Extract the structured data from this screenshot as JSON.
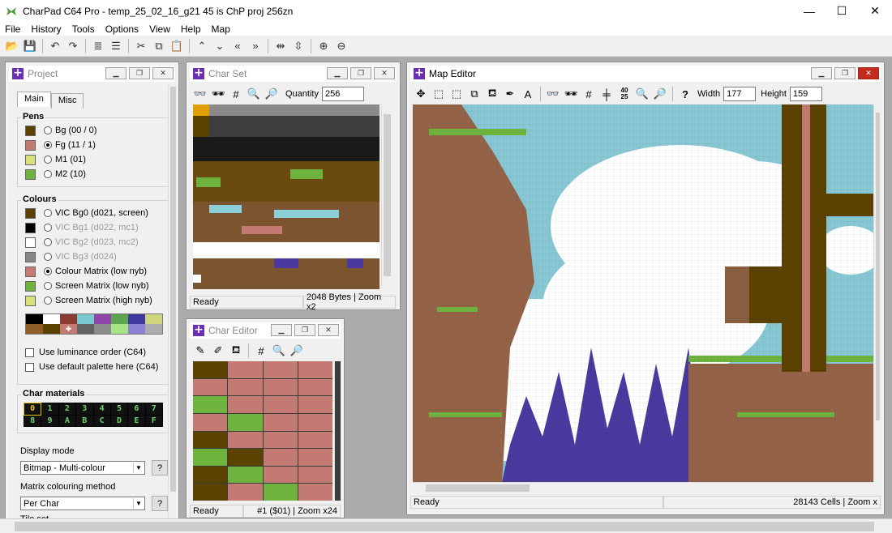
{
  "window": {
    "title": "CharPad C64 Pro - temp_25_02_16_g21 45 is ChP proj 256zn",
    "minimize": "—",
    "maximize": "☐",
    "close": "✕"
  },
  "menu": [
    "File",
    "History",
    "Tools",
    "Options",
    "View",
    "Help",
    "Map"
  ],
  "project": {
    "title": "Project",
    "tabs": [
      "Main",
      "Misc"
    ],
    "pens_title": "Pens",
    "pens": [
      {
        "label": "Bg (00 / 0)",
        "color": "#5b4200",
        "selected": false
      },
      {
        "label": "Fg (11 / 1)",
        "color": "#c27a72",
        "selected": true
      },
      {
        "label": "M1 (01)",
        "color": "#d9e07c",
        "selected": false
      },
      {
        "label": "M2 (10)",
        "color": "#6fb33f",
        "selected": false
      }
    ],
    "colours_title": "Colours",
    "colours": [
      {
        "label": "VIC Bg0 (d021, screen)",
        "color": "#5b4200",
        "enabled": true,
        "selected": false
      },
      {
        "label": "VIC Bg1 (d022, mc1)",
        "color": "#000000",
        "enabled": false,
        "selected": false
      },
      {
        "label": "VIC Bg2 (d023, mc2)",
        "color": "#ffffff",
        "enabled": false,
        "selected": false
      },
      {
        "label": "VIC Bg3 (d024)",
        "color": "#888888",
        "enabled": false,
        "selected": false
      },
      {
        "label": "Colour Matrix (low nyb)",
        "color": "#c27a72",
        "enabled": true,
        "selected": true
      },
      {
        "label": "Screen Matrix (low nyb)",
        "color": "#6fb33f",
        "enabled": true,
        "selected": false
      },
      {
        "label": "Screen Matrix (high nyb)",
        "color": "#d9e07c",
        "enabled": true,
        "selected": false
      }
    ],
    "palette": [
      "#000000",
      "#ffffff",
      "#8a3c33",
      "#7ac8cf",
      "#8e45a8",
      "#5ca450",
      "#40379f",
      "#cfd67e",
      "#8f5e28",
      "#5b4200",
      "#c27a72",
      "#636363",
      "#8b8b8b",
      "#a8e388",
      "#8b82d4",
      "#adadad"
    ],
    "checkbox_luminance": "Use luminance order (C64)",
    "checkbox_default_palette": "Use default palette here (C64)",
    "materials_title": "Char materials",
    "materials": [
      "0",
      "1",
      "2",
      "3",
      "4",
      "5",
      "6",
      "7",
      "8",
      "9",
      "A",
      "B",
      "C",
      "D",
      "E",
      "F"
    ],
    "display_mode_label": "Display mode",
    "display_mode_value": "Bitmap - Multi-colour",
    "matrix_method_label": "Matrix colouring method",
    "matrix_method_value": "Per Char",
    "tile_set_label": "Tile set",
    "help_btn": "?"
  },
  "charset": {
    "title": "Char Set",
    "quantity_label": "Quantity",
    "quantity_value": "256",
    "status_left": "Ready",
    "status_right": "2048 Bytes | Zoom x2"
  },
  "chareditor": {
    "title": "Char Editor",
    "status_left": "Ready",
    "status_right": "#1 ($01) | Zoom x24",
    "pixels": [
      "b",
      "p",
      "p",
      "p",
      "p",
      "p",
      "p",
      "p",
      "g",
      "p",
      "p",
      "p",
      "p",
      "g",
      "p",
      "p",
      "b",
      "p",
      "p",
      "p",
      "g",
      "b",
      "p",
      "p",
      "b",
      "g",
      "p",
      "p",
      "b",
      "p",
      "g",
      "p"
    ]
  },
  "map": {
    "title": "Map Editor",
    "width_label": "Width",
    "width_value": "177",
    "height_label": "Height",
    "height_value": "159",
    "status_left": "Ready",
    "status_right": "28143 Cells | Zoom x",
    "tool_40_25": "40\n25"
  }
}
